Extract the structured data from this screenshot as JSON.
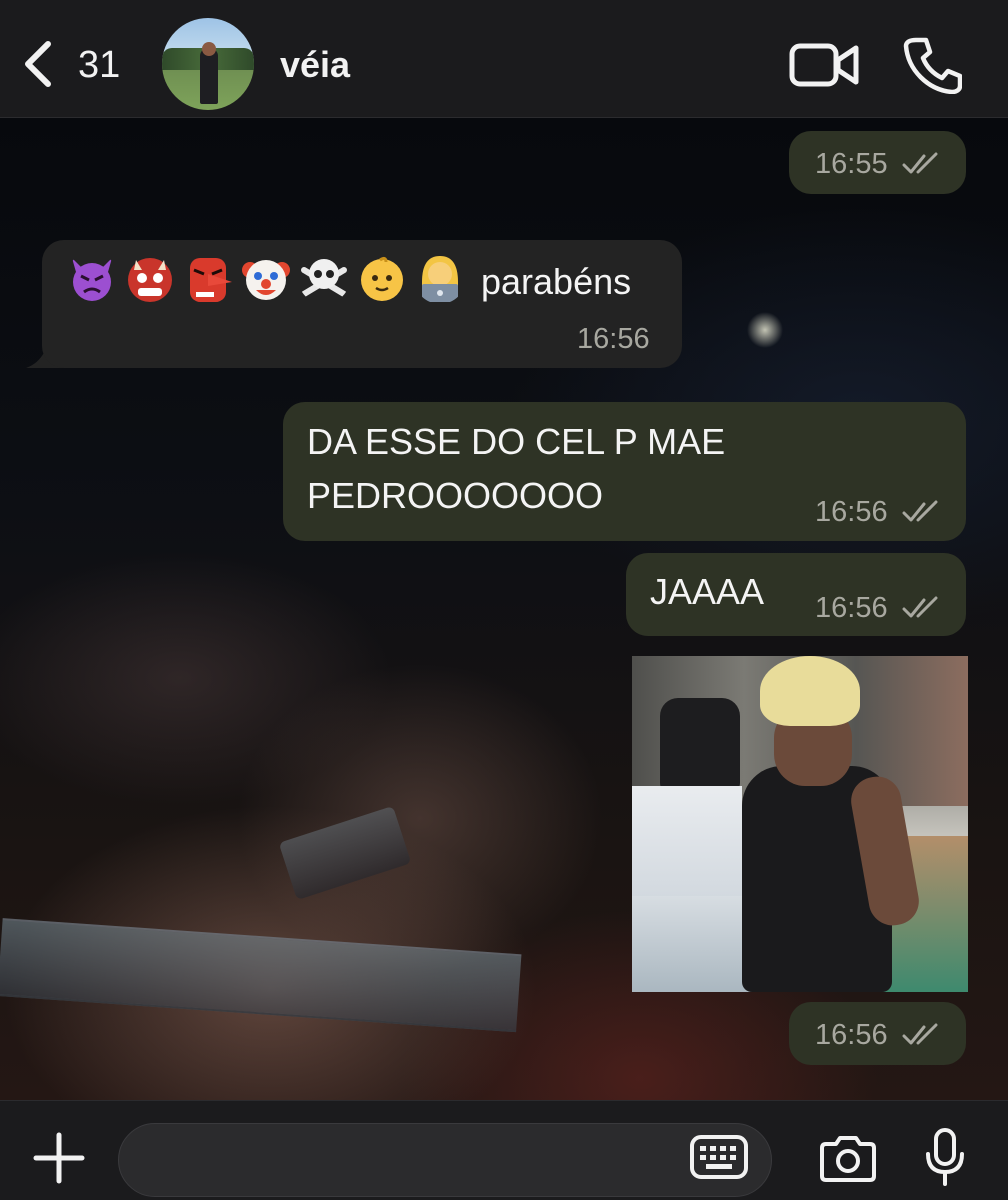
{
  "header": {
    "back_count": "31",
    "contact_name": "véia",
    "icons": [
      "chevron-left-icon",
      "video-call-icon",
      "phone-icon"
    ]
  },
  "messages": [
    {
      "direction": "outgoing",
      "text": "",
      "time": "16:55",
      "status": "read"
    },
    {
      "direction": "incoming",
      "emojis": [
        "👿",
        "👹",
        "👺",
        "🤡",
        "☠️",
        "👶",
        "👩‍💻"
      ],
      "text": "parabéns",
      "time": "16:56"
    },
    {
      "direction": "outgoing",
      "lines": [
        "DA ESSE DO CEL P MAE",
        "PEDROOOOOOO"
      ],
      "time": "16:56",
      "status": "read"
    },
    {
      "direction": "outgoing",
      "text": "JAAAA",
      "time": "16:56",
      "status": "read"
    },
    {
      "direction": "outgoing",
      "type": "image",
      "time": "16:56",
      "status": "read"
    }
  ],
  "composer": {
    "placeholder": "",
    "icons": [
      "plus-icon",
      "keyboard-icon",
      "camera-icon",
      "microphone-icon"
    ]
  },
  "colors": {
    "outgoing_bubble": "#2e3325",
    "incoming_bubble": "#232323",
    "header_bg": "#1c1c1e"
  }
}
